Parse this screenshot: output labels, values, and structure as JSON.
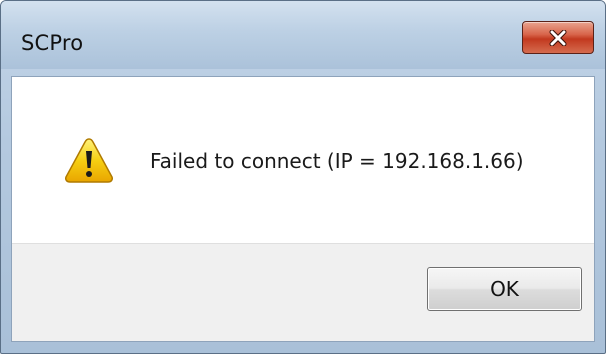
{
  "window": {
    "title": "SCPro"
  },
  "titlebar": {
    "close_icon": "close-x-icon"
  },
  "dialog": {
    "icon": "warning-icon",
    "message": "Failed to connect (IP = 192.168.1.66)"
  },
  "buttons": {
    "ok_label": "OK"
  },
  "colors": {
    "close_button": "#c2391f",
    "warning_fill": "#f5c400",
    "titlebar": "#bcd0e4",
    "button_area": "#f0f0f0"
  }
}
